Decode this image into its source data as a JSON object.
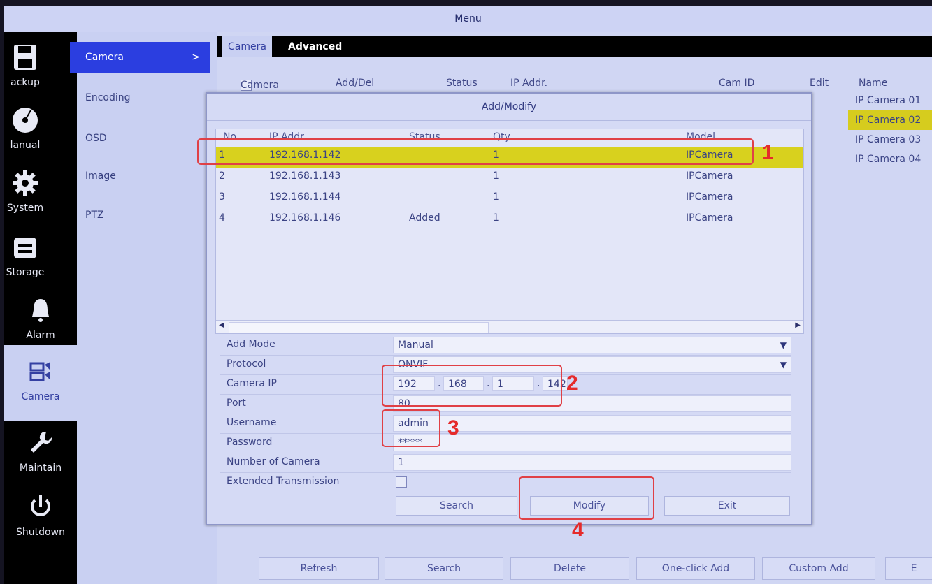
{
  "window": {
    "title": "Menu"
  },
  "iconbar": {
    "items": [
      {
        "label": "ackup",
        "icon": "floppy-disk-icon"
      },
      {
        "label": "lanual",
        "icon": "disc-icon"
      },
      {
        "label": "System",
        "icon": "gear-icon"
      },
      {
        "label": "Storage",
        "icon": "storage-icon"
      },
      {
        "label": "Alarm",
        "icon": "bell-icon"
      },
      {
        "label": "Camera",
        "icon": "camera-icon"
      },
      {
        "label": "Maintain",
        "icon": "wrench-icon"
      },
      {
        "label": "Shutdown",
        "icon": "power-icon"
      }
    ]
  },
  "submenu": {
    "items": [
      {
        "label": "Camera",
        "arrow": ">"
      },
      {
        "label": "Encoding"
      },
      {
        "label": "OSD"
      },
      {
        "label": "Image"
      },
      {
        "label": "PTZ"
      }
    ]
  },
  "tabs": [
    {
      "label": "Camera"
    },
    {
      "label": "Advanced"
    }
  ],
  "list": {
    "headers": [
      "Camera",
      "Add/Del",
      "Status",
      "IP Addr.",
      "Cam ID",
      "Edit",
      "Name"
    ],
    "names": [
      "IP Camera 01",
      "IP Camera 02",
      "IP Camera 03",
      "IP Camera 04"
    ]
  },
  "bottom_buttons": [
    "Refresh",
    "Search",
    "Delete",
    "One-click Add",
    "Custom Add",
    "E"
  ],
  "dialog": {
    "title": "Add/Modify",
    "grid": {
      "headers": [
        "No.",
        "IP Addr.",
        "Status",
        "Qty",
        "Model"
      ],
      "rows": [
        {
          "no": "1",
          "ip": "192.168.1.142",
          "status": "",
          "qty": "1",
          "model": "IPCamera"
        },
        {
          "no": "2",
          "ip": "192.168.1.143",
          "status": "",
          "qty": "1",
          "model": "IPCamera"
        },
        {
          "no": "3",
          "ip": "192.168.1.144",
          "status": "",
          "qty": "1",
          "model": "IPCamera"
        },
        {
          "no": "4",
          "ip": "192.168.1.146",
          "status": "Added",
          "qty": "1",
          "model": "IPCamera"
        }
      ]
    },
    "form": {
      "add_mode": {
        "label": "Add Mode",
        "value": "Manual"
      },
      "protocol": {
        "label": "Protocol",
        "value": "ONVIF"
      },
      "camera_ip": {
        "label": "Camera IP",
        "seg1": "192",
        "seg2": "168",
        "seg3": "1",
        "seg4": "142",
        "dot": "."
      },
      "port": {
        "label": "Port",
        "value": "80"
      },
      "username": {
        "label": "Username",
        "value": "admin"
      },
      "password": {
        "label": "Password",
        "value": "*****"
      },
      "number_of_camera": {
        "label": "Number of Camera",
        "value": "1"
      },
      "extended_transmission": {
        "label": "Extended Transmission",
        "checked": false
      }
    },
    "buttons": {
      "search": "Search",
      "modify": "Modify",
      "exit": "Exit"
    }
  },
  "callouts": [
    "1",
    "2",
    "3",
    "4"
  ],
  "colors": {
    "accent": "#2b3ee0",
    "highlight": "#d8d11e",
    "callout": "#e04046"
  }
}
